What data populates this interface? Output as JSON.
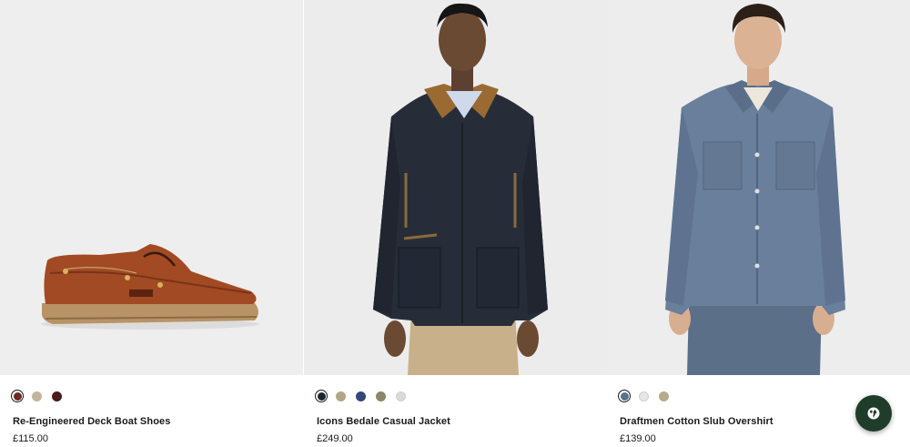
{
  "products": [
    {
      "name": "Re-Engineered Deck Boat Shoes",
      "price": "£115.00",
      "image_icon": "boat-shoe-photo",
      "swatches": [
        {
          "color": "#6b2a22",
          "selected": true
        },
        {
          "color": "#c2b59d",
          "selected": false
        },
        {
          "color": "#4a1c1a",
          "selected": false
        }
      ]
    },
    {
      "name": "Icons Bedale Casual Jacket",
      "price": "£249.00",
      "image_icon": "navy-jacket-photo",
      "swatches": [
        {
          "color": "#1f2530",
          "selected": true
        },
        {
          "color": "#b3a684",
          "selected": false
        },
        {
          "color": "#34477a",
          "selected": false
        },
        {
          "color": "#8a8768",
          "selected": false
        },
        {
          "color": "#dcdad3",
          "selected": false
        }
      ]
    },
    {
      "name": "Draftmen Cotton Slub Overshirt",
      "price": "£139.00",
      "image_icon": "blue-overshirt-photo",
      "swatches": [
        {
          "color": "#5b6f8f",
          "selected": true
        },
        {
          "color": "#e7e7e7",
          "selected": false
        },
        {
          "color": "#b8a98d",
          "selected": false
        }
      ]
    }
  ],
  "fab": {
    "icon": "globe-icon",
    "color": "#1f3d2a"
  }
}
